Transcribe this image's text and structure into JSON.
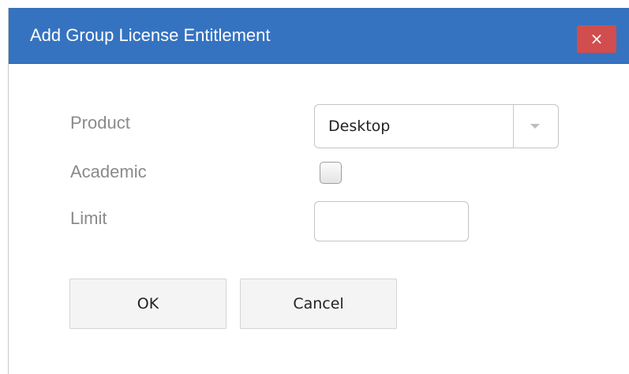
{
  "dialog": {
    "title": "Add Group License Entitlement",
    "close_label": "×"
  },
  "form": {
    "product_label": "Product",
    "product_value": "Desktop",
    "product_options": [
      "Desktop"
    ],
    "academic_label": "Academic",
    "academic_checked": false,
    "limit_label": "Limit",
    "limit_value": "",
    "limit_placeholder": ""
  },
  "buttons": {
    "ok_label": "OK",
    "cancel_label": "Cancel"
  },
  "colors": {
    "titlebar": "#3573c0",
    "close_button": "#d24d4d",
    "label_text": "#8a8a8a"
  }
}
